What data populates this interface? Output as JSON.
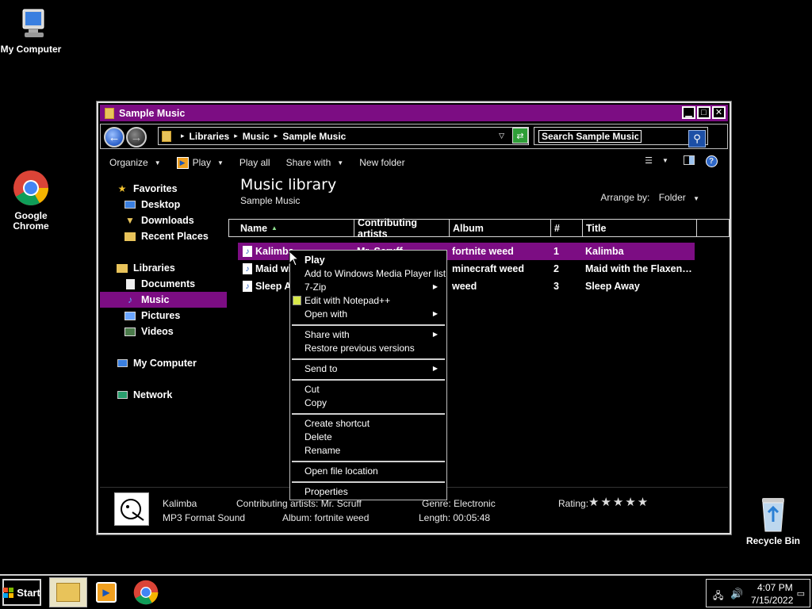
{
  "desktop": {
    "my_computer": "My Computer",
    "chrome": "Google Chrome",
    "recycle_bin": "Recycle Bin"
  },
  "window": {
    "title": "Sample Music",
    "breadcrumb": [
      "Libraries",
      "Music",
      "Sample Music"
    ],
    "search_placeholder": "Search Sample Music"
  },
  "toolbar": {
    "organize": "Organize",
    "play": "Play",
    "play_all": "Play all",
    "share_with": "Share with",
    "new_folder": "New folder"
  },
  "nav": {
    "favorites": "Favorites",
    "desktop": "Desktop",
    "downloads": "Downloads",
    "recent_places": "Recent Places",
    "libraries": "Libraries",
    "documents": "Documents",
    "music": "Music",
    "pictures": "Pictures",
    "videos": "Videos",
    "my_computer": "My Computer",
    "network": "Network"
  },
  "content": {
    "title": "Music library",
    "subtitle": "Sample Music",
    "arrange_label": "Arrange by:",
    "arrange_value": "Folder",
    "columns": [
      "Name",
      "Contributing artists",
      "Album",
      "#",
      "Title"
    ],
    "rows": [
      {
        "name": "Kalimba",
        "artist": "Mr. Scruff",
        "album": "fortnite weed",
        "num": "1",
        "title": "Kalimba"
      },
      {
        "name": "Maid wi",
        "artist": "",
        "album": "minecraft weed",
        "num": "2",
        "title": "Maid with the Flaxen…"
      },
      {
        "name": "Sleep A",
        "artist": "",
        "album": "weed",
        "num": "3",
        "title": "Sleep Away"
      }
    ]
  },
  "context_menu": {
    "play": "Play",
    "add_wmp": "Add to Windows Media Player list",
    "zip": "7-Zip",
    "notepad": "Edit with Notepad++",
    "open_with": "Open with",
    "share_with": "Share with",
    "restore": "Restore previous versions",
    "send_to": "Send to",
    "cut": "Cut",
    "copy": "Copy",
    "create_shortcut": "Create shortcut",
    "delete": "Delete",
    "rename": "Rename",
    "open_location": "Open file location",
    "properties": "Properties"
  },
  "details": {
    "name": "Kalimba",
    "type": "MP3 Format Sound",
    "artists": "Contributing artists: Mr. Scruff",
    "album": "Album: fortnite weed",
    "genre": "Genre: Electronic",
    "length": "Length: 00:05:48",
    "rating_label": "Rating:",
    "rating_stars": "★★★★★"
  },
  "taskbar": {
    "start": "Start",
    "time": "4:07 PM",
    "date": "7/15/2022"
  }
}
